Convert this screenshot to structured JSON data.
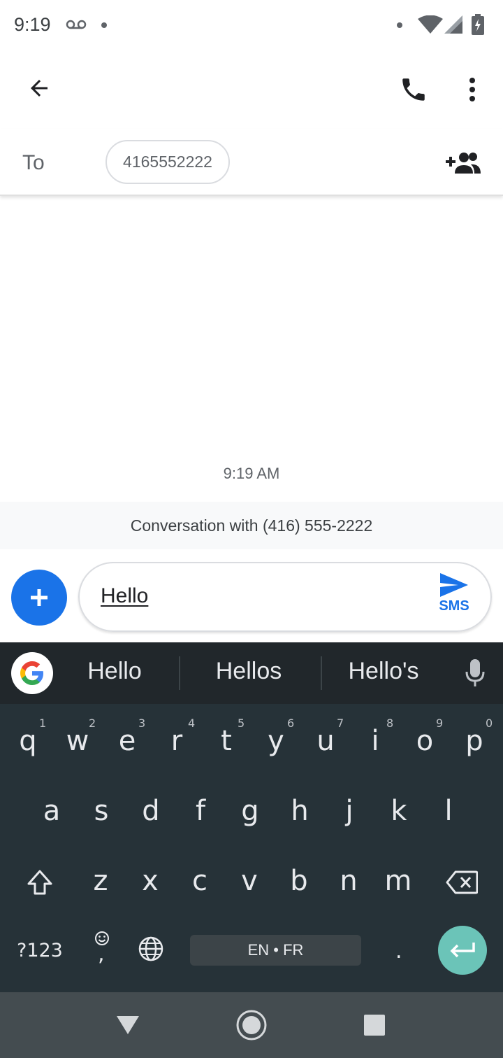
{
  "status_bar": {
    "time": "9:19",
    "icons": [
      "voicemail-icon",
      "notification-dot-icon",
      "wifi-icon",
      "signal-icon",
      "battery-charging-icon"
    ]
  },
  "toolbar": {
    "back_icon": "arrow-left-icon",
    "call_icon": "phone-icon",
    "menu_icon": "more-vert-icon"
  },
  "recipient": {
    "to_label": "To",
    "chip": "4165552222",
    "add_icon": "add-person-icon"
  },
  "conversation": {
    "timestamp": "9:19 AM",
    "banner": "Conversation with (416) 555-2222"
  },
  "compose": {
    "text": "Hello",
    "send_label": "SMS",
    "accent": "#1a73e8"
  },
  "keyboard": {
    "suggestions": [
      "Hello",
      "Hellos",
      "Hello's"
    ],
    "row1": [
      "q",
      "w",
      "e",
      "r",
      "t",
      "y",
      "u",
      "i",
      "o",
      "p"
    ],
    "row1_hints": [
      "1",
      "2",
      "3",
      "4",
      "5",
      "6",
      "7",
      "8",
      "9",
      "0"
    ],
    "row2": [
      "a",
      "s",
      "d",
      "f",
      "g",
      "h",
      "j",
      "k",
      "l"
    ],
    "row3": [
      "z",
      "x",
      "c",
      "v",
      "b",
      "n",
      "m"
    ],
    "symbols_key": "?123",
    "comma_key": ",",
    "space_label": "EN • FR",
    "period_key": ".",
    "enter_color": "#6bc4b8"
  },
  "nav_bar": {
    "icons": [
      "back-triangle-icon",
      "home-circle-icon",
      "recents-square-icon"
    ]
  }
}
